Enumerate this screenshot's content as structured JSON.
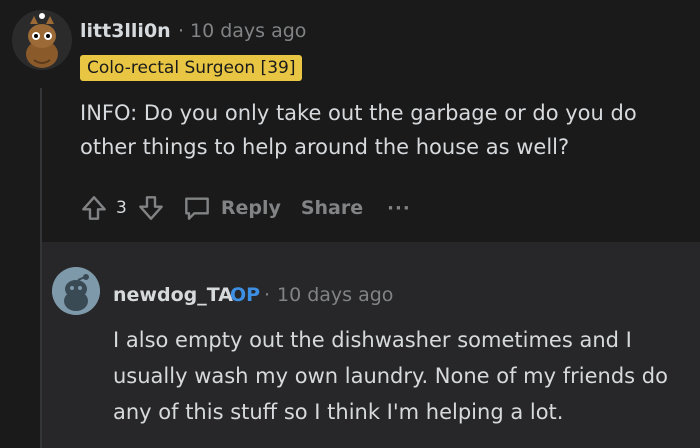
{
  "comment": {
    "username": "litt3lli0n",
    "separator": "·",
    "timestamp": "10 days ago",
    "flair": "Colo-rectal Surgeon [39]",
    "body": "INFO: Do you only take out the garbage or do you do other things to help around the house as well?",
    "votes": "3",
    "reply_label": "Reply",
    "share_label": "Share",
    "more_label": "···"
  },
  "reply": {
    "username": "newdog_TA",
    "op_badge": "OP",
    "separator": "·",
    "timestamp": "10 days ago",
    "body": "I also empty out the dishwasher sometimes and I usually wash my own laundry. None of my friends do any of this stuff so I think I'm helping a lot."
  },
  "colors": {
    "background": "#1a1a1b",
    "reply_background": "#272729",
    "flair_bg": "#e8c543",
    "op_blue": "#3d8fe4",
    "muted": "#818384"
  },
  "icons": [
    "upvote-icon",
    "downvote-icon",
    "comment-bubble-icon",
    "more-options-icon"
  ]
}
